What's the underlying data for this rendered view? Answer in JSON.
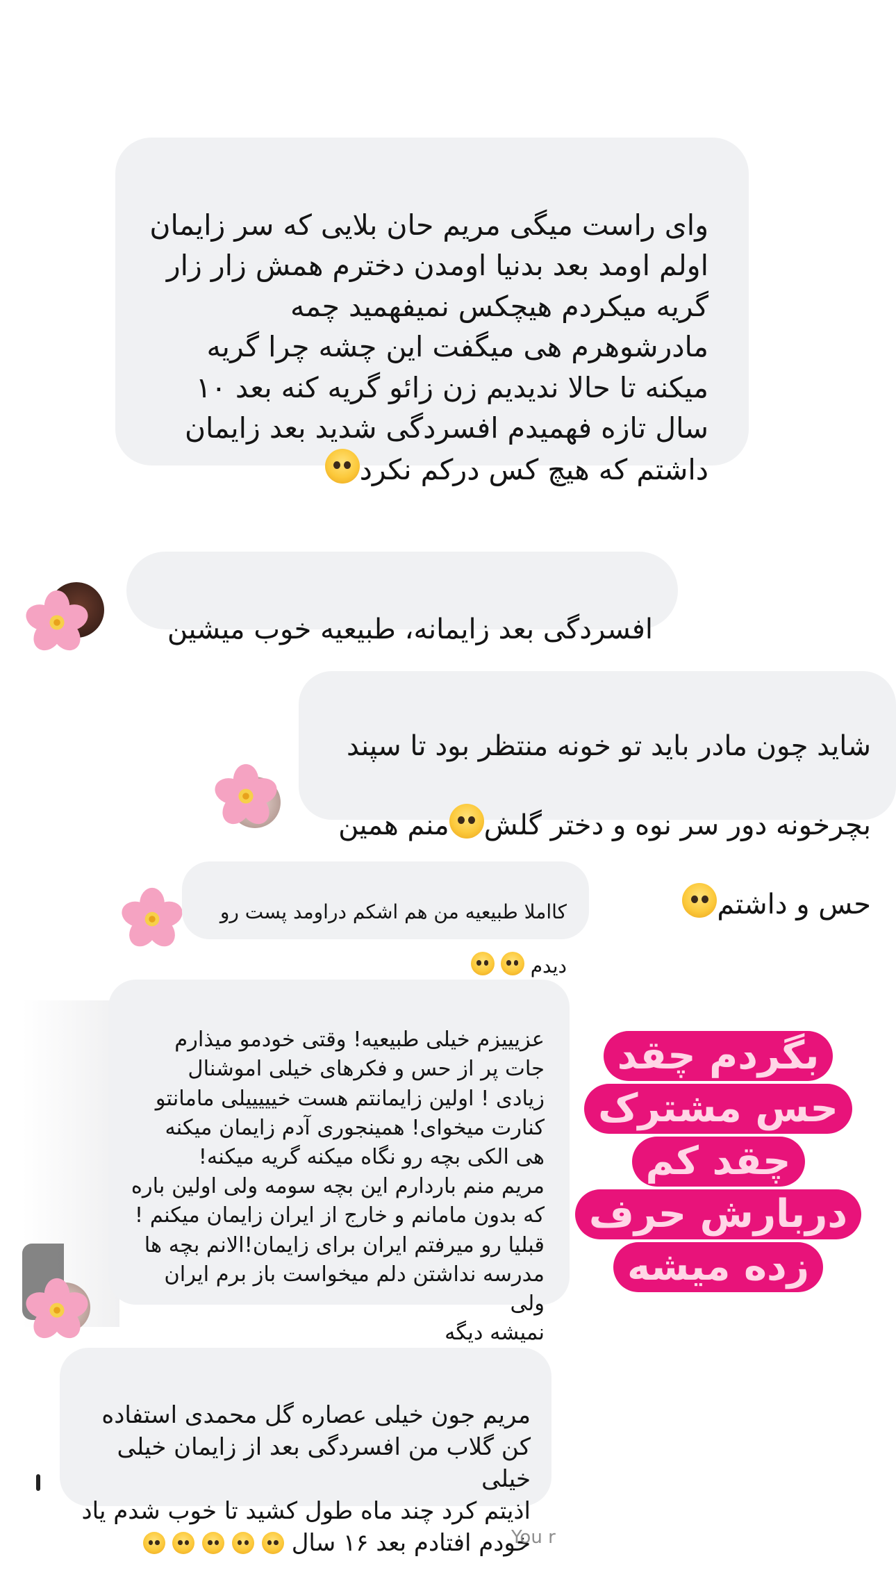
{
  "messages": [
    {
      "text": "وای راست میگی مریم حان بلایی که سر زایمان\nاولم اومد بعد بدنیا اومدن دخترم همش زار زار\nگریه میکردم هیچکس نمیفهمید چمه\nمادرشوهرم هی میگفت این چشه چرا گریه\nمیکنه تا حالا ندیدیم زن زائو گریه کنه بعد ۱۰\nسال تازه فهمیدم افسردگی شدید بعد زایمان\nداشتم که هیچ کس درکم نکرد",
      "emoji": "pensive-face-emoji"
    },
    {
      "text": "افسردگی بعد زایمانه، طبیعیه خوب میشین"
    },
    {
      "line1": "شاید چون مادر باید تو خونه منتظر بود تا سپند",
      "line2": "بچرخونه دور سر نوه و دختر گلش",
      "line2b": "منم همین",
      "line3": "حس و داشتم",
      "emoji": "pleading-face-emoji"
    },
    {
      "line1": "کااملا طبیعیه   من  هم اشکم دراومد  پست رو",
      "line2": "دیدم",
      "emoji": "pleading-face-emoji"
    },
    {
      "text": "عزیییزم خیلی طبیعیه! وقتی خودمو میذارم\nجات پر از حس و فکرهای خیلی اموشنال\nزیادی ! اولین زایمانتم هست خیییییلی مامانتو\nکنارت میخوای! همینجوری آدم زایمان میکنه\nهی الکی بچه رو نگاه میکنه گریه میکنه!\nمریم منم باردارم این بچه سومه ولی اولین باره\nکه بدون مامانم و خارج از ایران زایمان میکنم !\nقبلیا رو میرفتم ایران برای زایمان!الانم بچه ها\nمدرسه نداشتن دلم میخواست باز برم ایران ولی\nنمیشه دیگه"
    },
    {
      "text": "مریم جون خیلی عصاره گل محمدی استفاده\nکن گلاب من افسردگی بعد از زایمان خیلی خیلی\nاذیتم کرد چند ماه طول کشید تا خوب شدم یاد",
      "last_line": "خودم افتادم بعد ۱۶ سال",
      "emoji": "loudly-crying-face-emoji"
    }
  ],
  "sticker": {
    "lines": [
      "بگردم چقد",
      "حس مشترک",
      "چقد کم",
      "دربارش حرف",
      "زده میشه"
    ],
    "background": "#e8137a",
    "text_color": "#ffd6e6"
  },
  "footer": {
    "label": "You r"
  },
  "colors": {
    "bubble": "#f0f1f3",
    "background": "#ffffff"
  }
}
